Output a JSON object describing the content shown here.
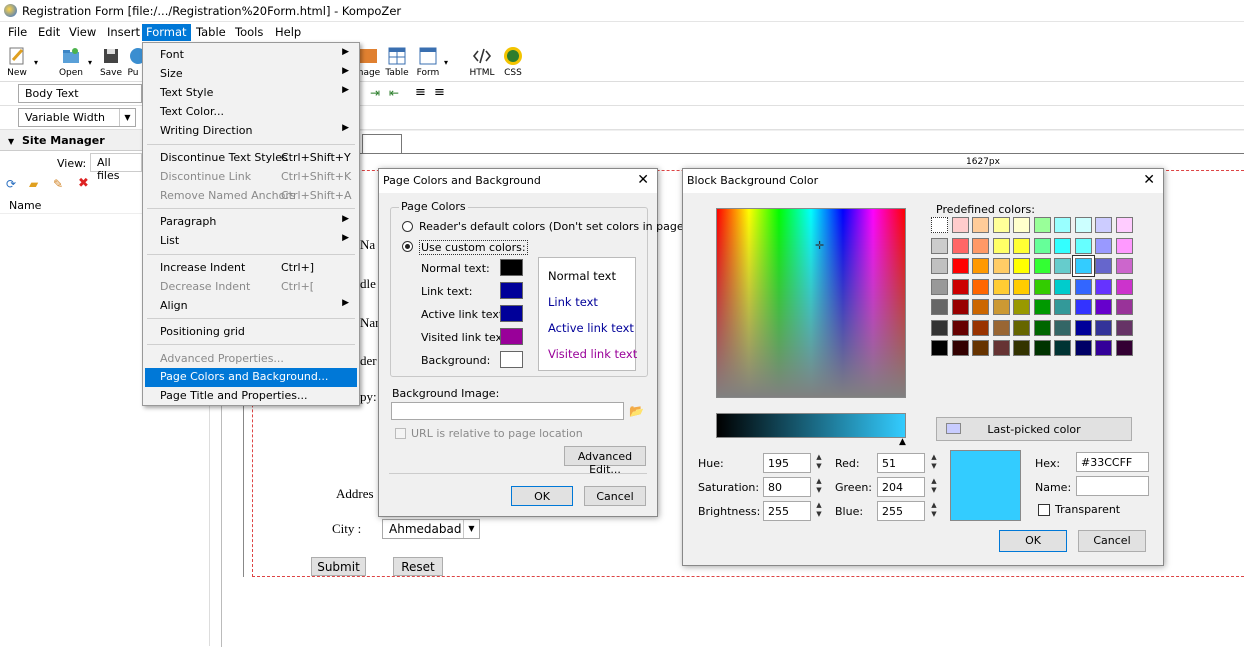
{
  "window": {
    "title": "Registration Form [file:/.../Registration%20Form.html] - KompoZer"
  },
  "menubar": {
    "items": [
      "File",
      "Edit",
      "View",
      "Insert",
      "Format",
      "Table",
      "Tools",
      "Help"
    ]
  },
  "toolbar": {
    "new": "New",
    "open": "Open",
    "save": "Save",
    "publish_partial": "Pu",
    "image_partial": "nage",
    "table": "Table",
    "form": "Form",
    "html": "HTML",
    "css": "CSS"
  },
  "format_bar": {
    "paragraph_style": "Body Text",
    "font_width": "Variable Width"
  },
  "site_manager": {
    "title": "Site Manager",
    "view_label": "View:",
    "view_value": "All files",
    "name_header": "Name"
  },
  "ruler": {
    "width_label": "1627px"
  },
  "page_content": {
    "labels_partial": [
      "Na",
      "dle N",
      "Nar",
      "der :",
      "py:"
    ],
    "address_label": "Addres",
    "city_label": "City :",
    "city_value": "Ahmedabad",
    "submit": "Submit",
    "reset": "Reset"
  },
  "format_menu": {
    "font": "Font",
    "size": "Size",
    "text_style": "Text Style",
    "text_color": "Text Color...",
    "writing_direction": "Writing Direction",
    "discontinue_text_styles": "Discontinue Text Styles",
    "discontinue_text_styles_sc": "Ctrl+Shift+Y",
    "discontinue_link": "Discontinue Link",
    "discontinue_link_sc": "Ctrl+Shift+K",
    "remove_named_anchors": "Remove Named Anchors",
    "remove_named_anchors_sc": "Ctrl+Shift+A",
    "paragraph": "Paragraph",
    "list": "List",
    "increase_indent": "Increase Indent",
    "increase_indent_sc": "Ctrl+]",
    "decrease_indent": "Decrease Indent",
    "decrease_indent_sc": "Ctrl+[",
    "align": "Align",
    "positioning_grid": "Positioning grid",
    "advanced_properties": "Advanced Properties...",
    "page_colors": "Page Colors and Background...",
    "page_title": "Page Title and Properties..."
  },
  "page_colors_dialog": {
    "title": "Page Colors and Background",
    "group": "Page Colors",
    "default_colors": "Reader's default colors (Don't set colors in page)",
    "custom_colors": "Use custom colors:",
    "normal_text": "Normal text:",
    "link_text": "Link text:",
    "active_link_text": "Active link text:",
    "visited_link_text": "Visited link text:",
    "background": "Background:",
    "preview_normal": "Normal text",
    "preview_link": "Link text",
    "preview_active": "Active link text",
    "preview_visited": "Visited link text",
    "background_image": "Background Image:",
    "url_relative": "URL is relative to page location",
    "advanced_edit": "Advanced Edit...",
    "ok": "OK",
    "cancel": "Cancel",
    "colors": {
      "normal": "#000000",
      "link": "#000099",
      "active": "#000099",
      "visited": "#990099",
      "background": "#ffffff"
    }
  },
  "color_dialog": {
    "title": "Block Background Color",
    "predefined": "Predefined colors:",
    "last_picked": "Last-picked color",
    "hue_label": "Hue:",
    "hue": "195",
    "saturation_label": "Saturation:",
    "saturation": "80",
    "brightness_label": "Brightness:",
    "brightness": "255",
    "red_label": "Red:",
    "red": "51",
    "green_label": "Green:",
    "green": "204",
    "blue_label": "Blue:",
    "blue": "255",
    "hex_label": "Hex:",
    "hex": "#33CCFF",
    "name_label": "Name:",
    "name": "",
    "transparent": "Transparent",
    "ok": "OK",
    "cancel": "Cancel",
    "current_color": "#33CCFF",
    "last_picked_color": "#c8ccff",
    "palette": [
      [
        "#ffffff",
        "#ffcccc",
        "#ffcc99",
        "#ffff99",
        "#ffffcc",
        "#99ff99",
        "#99ffff",
        "#ccffff",
        "#ccccff",
        "#ffccff"
      ],
      [
        "#cccccc",
        "#ff6666",
        "#ff9966",
        "#ffff66",
        "#ffff33",
        "#66ff99",
        "#33ffff",
        "#66ffff",
        "#9999ff",
        "#ff99ff"
      ],
      [
        "#c0c0c0",
        "#ff0000",
        "#ff9900",
        "#ffcc66",
        "#ffff00",
        "#33ff33",
        "#66cccc",
        "#33ccff",
        "#6666cc",
        "#cc66cc"
      ],
      [
        "#999999",
        "#cc0000",
        "#ff6600",
        "#ffcc33",
        "#ffcc00",
        "#33cc00",
        "#00cccc",
        "#3366ff",
        "#6633ff",
        "#cc33cc"
      ],
      [
        "#666666",
        "#990000",
        "#cc6600",
        "#cc9933",
        "#999900",
        "#009900",
        "#339999",
        "#3333ff",
        "#6600cc",
        "#993399"
      ],
      [
        "#333333",
        "#660000",
        "#993300",
        "#996633",
        "#666600",
        "#006600",
        "#336666",
        "#000099",
        "#333399",
        "#663366"
      ],
      [
        "#000000",
        "#330000",
        "#663300",
        "#663333",
        "#333300",
        "#003300",
        "#003333",
        "#000066",
        "#330099",
        "#330033"
      ]
    ]
  }
}
